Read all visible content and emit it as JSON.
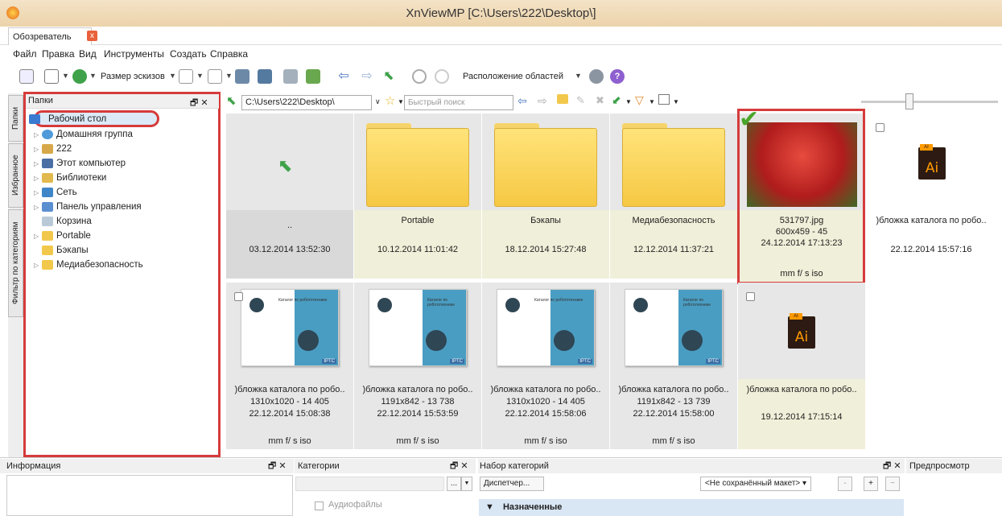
{
  "window": {
    "title": "XnViewMP [C:\\Users\\222\\Desktop\\]"
  },
  "tabs": [
    {
      "label": "Обозреватель",
      "close": "x"
    }
  ],
  "menu": [
    "Файл",
    "Правка",
    "Вид",
    "Инструменты",
    "Создать",
    "Справка"
  ],
  "toolbar": {
    "thumb_size_label": "Размер эскизов",
    "layout_label": "Расположение областей"
  },
  "side_tabs": [
    "Папки",
    "Избранное",
    "Фильтр по категориям"
  ],
  "folders_panel": {
    "title": "Папки",
    "controls": "🗗 ✕",
    "items": [
      {
        "label": "Рабочий стол",
        "icon": "desktop-icon"
      },
      {
        "label": "Домашняя группа",
        "icon": "homegroup-icon"
      },
      {
        "label": "222",
        "icon": "user-icon"
      },
      {
        "label": "Этот компьютер",
        "icon": "computer-icon"
      },
      {
        "label": "Библиотеки",
        "icon": "library-icon"
      },
      {
        "label": "Сеть",
        "icon": "network-icon"
      },
      {
        "label": "Панель управления",
        "icon": "control-panel-icon"
      },
      {
        "label": "Корзина",
        "icon": "recycle-bin-icon"
      },
      {
        "label": "Portable",
        "icon": "folder-icon"
      },
      {
        "label": "Бэкапы",
        "icon": "folder-icon"
      },
      {
        "label": "Медиабезопасность",
        "icon": "folder-icon"
      }
    ]
  },
  "pathbar": {
    "path": "C:\\Users\\222\\Desktop\\",
    "search_placeholder": "Быстрый поиск"
  },
  "grid": {
    "row1": [
      {
        "name": "..",
        "date": "03.12.2014 13:52:30"
      },
      {
        "name": "Portable",
        "date": "10.12.2014 11:01:42"
      },
      {
        "name": "Бэкапы",
        "date": "18.12.2014 15:27:48"
      },
      {
        "name": "Медиабезопасность",
        "date": "12.12.2014 11:37:21"
      },
      {
        "name": "531797.jpg",
        "info": "600x459 - 45",
        "date": "24.12.2014 17:13:23",
        "exif": "mm f/ s iso"
      },
      {
        "name": ")бложка каталога по робо..",
        "date": "22.12.2014 15:57:16"
      }
    ],
    "row2": [
      {
        "name": ")бложка каталога по робо..",
        "info": "1310x1020 - 14 405",
        "date": "22.12.2014 15:08:38",
        "exif": "mm f/ s iso"
      },
      {
        "name": ")бложка каталога по робо..",
        "info": "1191x842 - 13 738",
        "date": "22.12.2014 15:53:59",
        "exif": "mm f/ s iso"
      },
      {
        "name": ")бложка каталога по робо..",
        "info": "1310x1020 - 14 405",
        "date": "22.12.2014 15:58:06",
        "exif": "mm f/ s iso"
      },
      {
        "name": ")бложка каталога по робо..",
        "info": "1191x842 - 13 739",
        "date": "22.12.2014 15:58:00",
        "exif": "mm f/ s iso"
      },
      {
        "name": ")бложка каталога по робо..",
        "date": "19.12.2014 17:15:14"
      }
    ],
    "cover_title": "Каталог по робототехнике",
    "iptc": "IPTC",
    "ai_label": "Ai",
    "ai_tab": "AI"
  },
  "bottom": {
    "info_title": "Информация",
    "categories_title": "Категории",
    "category_set_title": "Набор категорий",
    "preview_title": "Предпросмотр",
    "dispatcher": "Диспетчер...",
    "layout_select": "<Не сохранённый макет>",
    "category_item": "Аудиофайлы",
    "assigned": "Назначенные",
    "pane_controls": "🗗 ✕",
    "ellipsis": "...",
    "plus": "+",
    "minus": "-",
    "tilde": "~"
  }
}
